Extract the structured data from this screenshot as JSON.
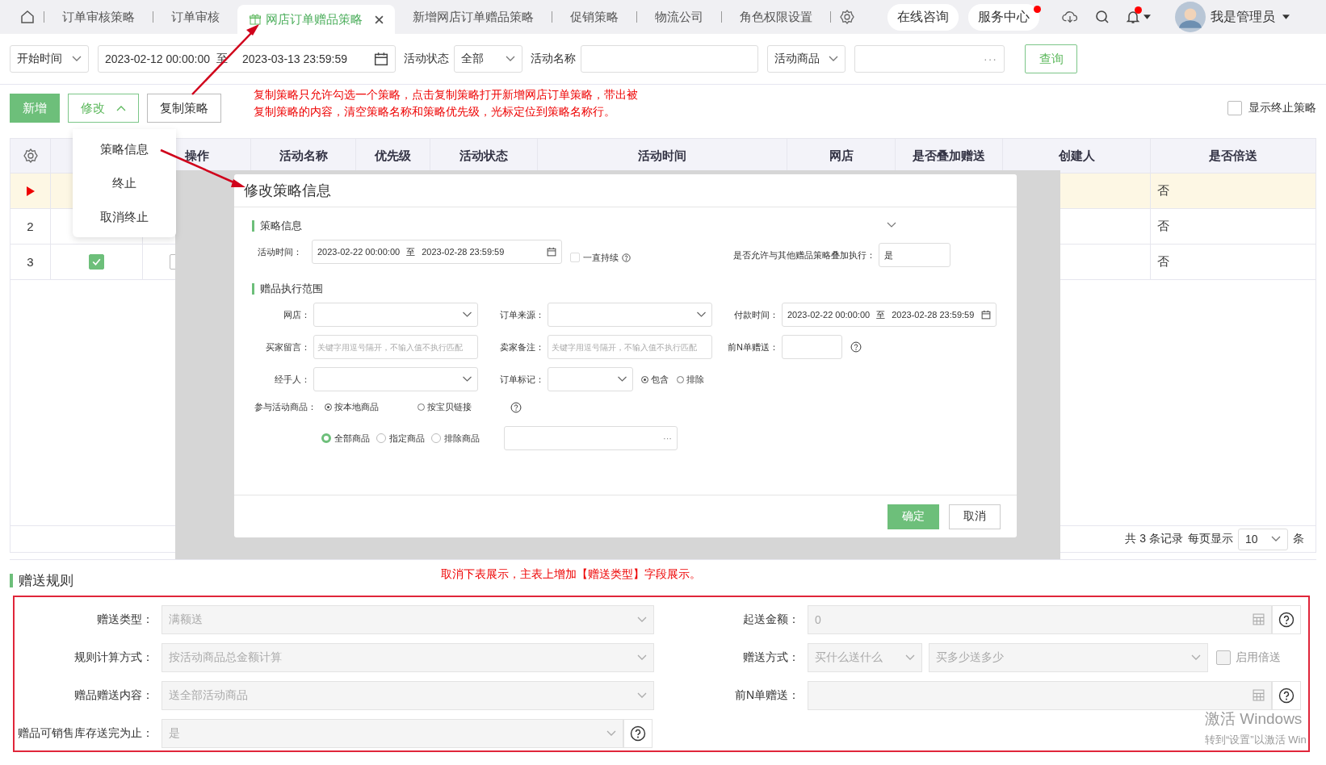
{
  "tabs": [
    {
      "label": "订单审核策略",
      "selected": false
    },
    {
      "label": "订单审核",
      "selected": false
    },
    {
      "label": "网店订单赠品策略",
      "selected": true
    },
    {
      "label": "新增网店订单赠品策略",
      "selected": false
    },
    {
      "label": "促销策略",
      "selected": false
    },
    {
      "label": "物流公司",
      "selected": false
    },
    {
      "label": "角色权限设置",
      "selected": false
    }
  ],
  "header": {
    "pills": [
      {
        "label": "在线咨询",
        "badge": false
      },
      {
        "label": "服务中心",
        "badge": true
      }
    ],
    "bell_badge": true,
    "user": "我是管理员"
  },
  "filters": {
    "time_type": "开始时间",
    "date_from": "2023-02-12 00:00:00",
    "date_sep": "至",
    "date_to": "2023-03-13 23:59:59",
    "status_label": "活动状态",
    "status_value": "全部",
    "name_label": "活动名称",
    "goods_select": "活动商品",
    "goods_more": "···",
    "query_button": "查询"
  },
  "toolbar": {
    "add": "新增",
    "edit": {
      "label": "修改",
      "expanded": true
    },
    "copy": "复制策略",
    "show_terminated": {
      "label": "显示终止策略",
      "checked": false
    }
  },
  "copy_note": [
    "复制策略只允许勾选一个策略，点击复制策略打开新增网店订单策略，带出被",
    "复制策略的内容，清空策略名称和策略优先级，光标定位到策略名称行。"
  ],
  "edit_menu": [
    "策略信息",
    "终止",
    "取消终止"
  ],
  "table": {
    "columns": [
      "操作",
      "活动名称",
      "优先级",
      "活动状态",
      "活动时间",
      "网店",
      "是否叠加赠送",
      "创建人",
      "是否倍送"
    ],
    "rows": [
      {
        "number": "",
        "selected": true,
        "double_gift": "否"
      },
      {
        "number": "2",
        "selected": false,
        "double_gift": "否"
      },
      {
        "number": "3",
        "selected": false,
        "checked": true,
        "action_checked": false,
        "double_gift": "否"
      }
    ]
  },
  "pagination": {
    "total": "共 3 条记录",
    "page_size_label": "每页显示",
    "page_size": "10",
    "unit": "条"
  },
  "modal": {
    "title": "修改策略信息",
    "section_1": "策略信息",
    "activity_time": {
      "label": "活动时间：",
      "from": "2023-02-22 00:00:00",
      "sep": "至",
      "to": "2023-02-28 23:59:59"
    },
    "always": {
      "label": "一直持续",
      "checked": false
    },
    "allow_stack": {
      "label": "是否允许与其他赠品策略叠加执行：",
      "value": "是"
    },
    "section_2": "赠品执行范围",
    "shop": "网店：",
    "source": "订单来源：",
    "pay_time": {
      "label": "付款时间：",
      "from": "2023-02-22 00:00:00",
      "sep": "至",
      "to": "2023-02-28 23:59:59"
    },
    "buyer_msg": {
      "label": "买家留言：",
      "placeholder": "关键字用逗号隔开，不输入值不执行匹配"
    },
    "seller_note": {
      "label": "卖家备注：",
      "placeholder": "关键字用逗号隔开，不输入值不执行匹配"
    },
    "first_n": "前N单赠送：",
    "handler": "经手人：",
    "order_mark": "订单标记：",
    "mark_mode": [
      {
        "label": "包含",
        "selected": true
      },
      {
        "label": "排除",
        "selected": false
      }
    ],
    "goods": {
      "label": "参与活动商品：",
      "options": [
        {
          "label": "按本地商品",
          "selected": true
        },
        {
          "label": "按宝贝链接",
          "selected": false
        }
      ]
    },
    "scope": [
      {
        "label": "全部商品",
        "selected": true
      },
      {
        "label": "指定商品",
        "selected": false
      },
      {
        "label": "排除商品",
        "selected": false
      }
    ],
    "scope_more": "···",
    "confirm": "确定",
    "cancel": "取消"
  },
  "rules": {
    "title": "赠送规则",
    "note": "取消下表展示，主表上增加【赠送类型】字段展示。",
    "disabled": true,
    "gift_type": {
      "label": "赠送类型：",
      "value": "满额送"
    },
    "start_amount": {
      "label": "起送金额：",
      "value": "0"
    },
    "calc": {
      "label": "规则计算方式：",
      "value": "按活动商品总金额计算"
    },
    "mode": {
      "label": "赠送方式：",
      "value_1": "买什么送什么",
      "value_2": "买多少送多少"
    },
    "double": {
      "label": "启用倍送",
      "checked": false
    },
    "content": {
      "label": "赠品赠送内容：",
      "value": "送全部活动商品"
    },
    "first_n": {
      "label": "前N单赠送："
    },
    "until": {
      "label": "赠品可销售库存送完为止：",
      "value": "是"
    }
  },
  "windows_notice": [
    "激活 Windows",
    "转到“设置”以激活 Win"
  ]
}
